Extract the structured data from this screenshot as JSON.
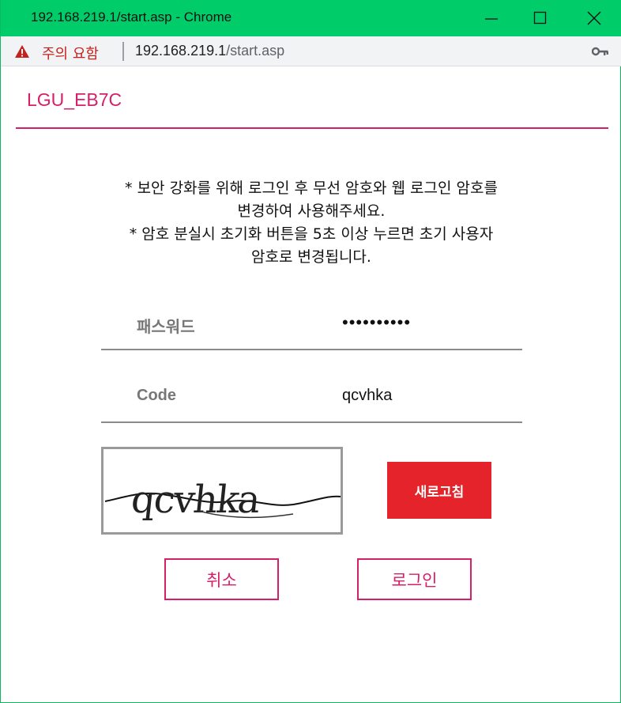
{
  "window": {
    "title": "192.168.219.1/start.asp - Chrome"
  },
  "addressbar": {
    "warning_text": "주의 요함",
    "url_host": "192.168.219.1",
    "url_path": "/start.asp"
  },
  "page": {
    "brand": "LGU_EB7C",
    "notice_lines": [
      "* 보안 강화를 위해 로그인 후 무선 암호와 웹 로그인 암호를",
      "변경하여 사용해주세요.",
      "* 암호 분실시 초기화 버튼을 5초 이상 누르면 초기 사용자",
      "암호로 변경됩니다."
    ],
    "password": {
      "label": "패스워드",
      "value_masked": "••••••••••"
    },
    "code": {
      "label": "Code",
      "value": "qcvhka"
    },
    "captcha": {
      "text": "qcvhka"
    },
    "refresh_label": "새로고침",
    "cancel_label": "취소",
    "login_label": "로그인"
  },
  "colors": {
    "titlebar": "#00cc6a",
    "brand": "#d61f69",
    "refresh_button": "#e4232a",
    "warning": "#c5221f"
  }
}
